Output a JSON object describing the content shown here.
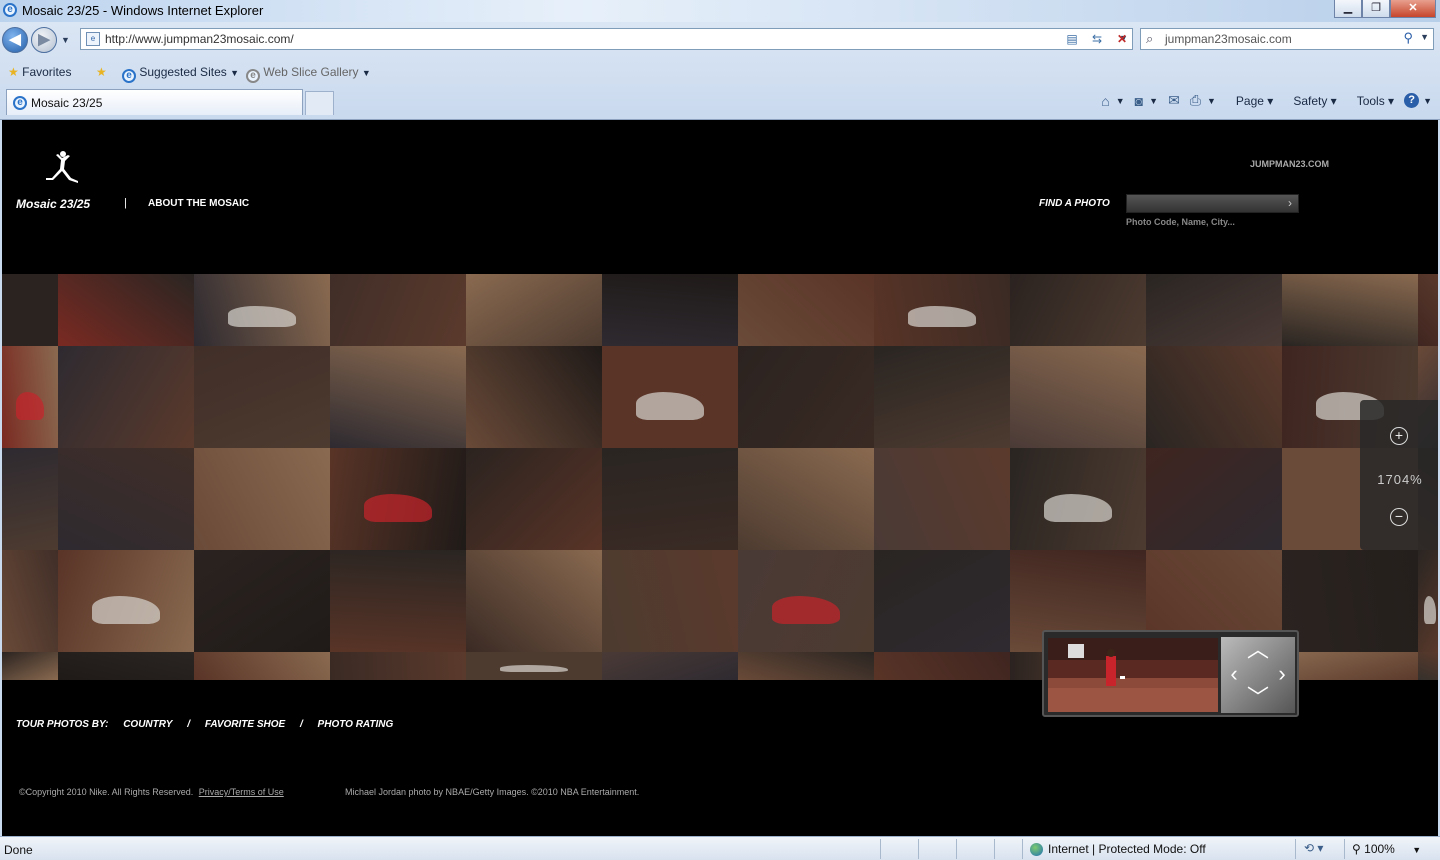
{
  "window": {
    "title": "Mosaic 23/25 - Windows Internet Explorer"
  },
  "nav": {
    "url": "http://www.jumpman23mosaic.com/",
    "search_value": "jumpman23mosaic.com"
  },
  "favorites_bar": {
    "favorites": "Favorites",
    "suggested": "Suggested Sites",
    "webslice": "Web Slice Gallery"
  },
  "tab": {
    "label": "Mosaic 23/25"
  },
  "commandbar": {
    "page": "Page",
    "safety": "Safety",
    "tools": "Tools"
  },
  "site": {
    "title": "Mosaic 23/25",
    "separator": "|",
    "about": "ABOUT THE MOSAIC",
    "jumpman": "JUMPMAN23.COM",
    "find_label": "FIND A PHOTO",
    "find_hint": "Photo Code, Name, City...",
    "zoom": "1704%",
    "tour_label": "TOUR PHOTOS BY:",
    "tour_country": "COUNTRY",
    "tour_shoe": "FAVORITE SHOE",
    "tour_rating": "PHOTO RATING",
    "tour_sep": "/",
    "copyright": "©Copyright 2010 Nike. All Rights Reserved.",
    "privacy": "Privacy/Terms of Use",
    "credit": "Michael Jordan photo by NBAE/Getty Images.    ©2010 NBA Entertainment."
  },
  "status": {
    "left": "Done",
    "zone": "Internet | Protected Mode: Off",
    "zoom": "100%"
  },
  "colors": {
    "ie_blue": "#2a73c9",
    "site_bg": "#000000",
    "red_shoe": "#c8242b"
  }
}
